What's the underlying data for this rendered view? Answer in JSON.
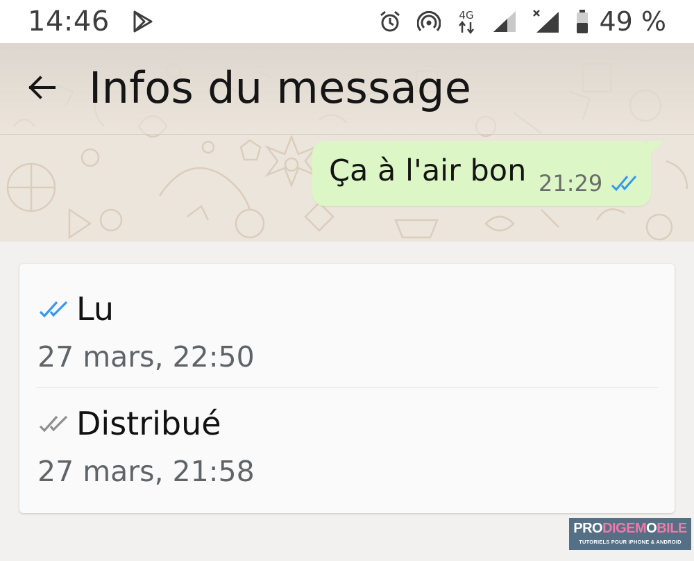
{
  "status_bar": {
    "time": "14:46",
    "left_icons": [
      "play-store-icon"
    ],
    "right_icons": [
      "alarm-icon",
      "hotspot-icon",
      "4g-data-icon",
      "signal-icon",
      "signal-no-service-icon",
      "battery-icon"
    ],
    "network_label": "4G",
    "battery_percent": "49 %"
  },
  "toolbar": {
    "back_icon": "arrow-left-icon",
    "title": "Infos du message"
  },
  "message": {
    "text": "Ça à l'air bon",
    "time": "21:29",
    "status_icon": "double-check-blue-icon"
  },
  "receipts": [
    {
      "status": "Lu",
      "time": "27 mars, 22:50",
      "icon": "double-check-blue-icon",
      "icon_color": "#3498f0"
    },
    {
      "status": "Distribué",
      "time": "27 mars, 21:58",
      "icon": "double-check-gray-icon",
      "icon_color": "#8e8e8e"
    }
  ],
  "watermark": {
    "logo_part1": "PRO",
    "logo_part2": "DIGEM",
    "logo_part3": "O",
    "logo_part4": "BILE",
    "tagline": "TUTORIELS POUR IPHONE & ANDROID"
  },
  "colors": {
    "bubble": "#dcf7c5",
    "read_ticks": "#3498f0",
    "delivered_ticks": "#8e8e8e",
    "wallpaper": "#ece5dc"
  }
}
